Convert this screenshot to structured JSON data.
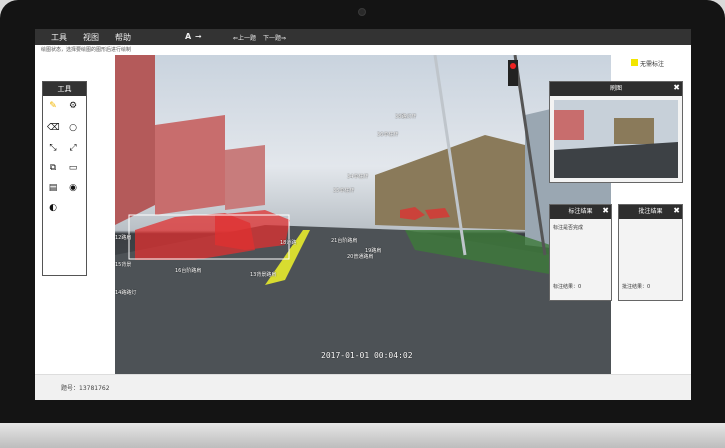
{
  "menu": {
    "tools": "工具",
    "view": "视图",
    "help": "帮助",
    "text_tool": "A",
    "prev": "⇐上一题",
    "next": "下一题⇒"
  },
  "hint": "绘图状态，选择要绘图的图形后进行绘制",
  "tool_panel": {
    "title": "工具",
    "icons": [
      "pencil-icon",
      "gear-icon",
      "eraser-icon",
      "circle-icon",
      "resize-icon",
      "expand-icon",
      "copy-icon",
      "monitor-icon",
      "document-icon",
      "chrome-icon",
      "contrast-icon"
    ]
  },
  "no_label": {
    "text": "无需标注"
  },
  "brush_window": {
    "title": "刷图"
  },
  "annot_result": {
    "title": "标注结果",
    "row1": "标注是否完成",
    "footer": "标注结果：0"
  },
  "review_result": {
    "title": "批注结果",
    "footer": "批注结果：0"
  },
  "timestamp": "2017-01-01 00:04:02",
  "status": {
    "id_text": "题号：13781762"
  },
  "annotations": [
    "14路路灯",
    "15背景",
    "16台阶路肩",
    "12路肩",
    "34单柱杆",
    "35单柱杆",
    "36单柱杆",
    "38路灯杆",
    "13背景路肩",
    "18道路",
    "19路肩",
    "20普通路肩",
    "21台阶路肩"
  ],
  "colors": {
    "accent": "#f2e600",
    "mask": "#e03030"
  }
}
